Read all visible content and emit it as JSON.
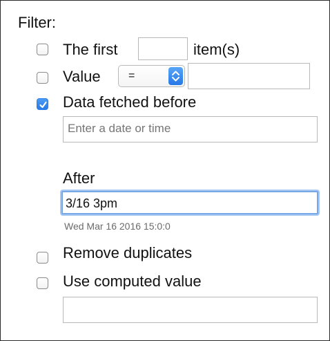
{
  "filter": {
    "title": "Filter:",
    "options": {
      "first": {
        "label_before": "The first",
        "label_after": "item(s)",
        "checked": false,
        "value": ""
      },
      "value": {
        "label": "Value",
        "checked": false,
        "operator": "=",
        "value": ""
      },
      "fetched_before": {
        "label": "Data fetched before",
        "checked": true,
        "placeholder": "Enter a date or time",
        "value": ""
      },
      "after": {
        "label": "After",
        "value": "3/16 3pm",
        "parsed": "Wed Mar 16 2016 15:0:0"
      },
      "remove_duplicates": {
        "label": "Remove duplicates",
        "checked": false
      },
      "use_computed_value": {
        "label": "Use computed value",
        "checked": false,
        "value": ""
      }
    }
  },
  "colors": {
    "accent": "#2a78e6",
    "focus": "#76a8e8",
    "text": "#111111",
    "placeholder": "#9a9a9a"
  },
  "icons": {
    "checkmark": "checkmark-icon",
    "select_arrows": "chevron-up-down-icon"
  }
}
